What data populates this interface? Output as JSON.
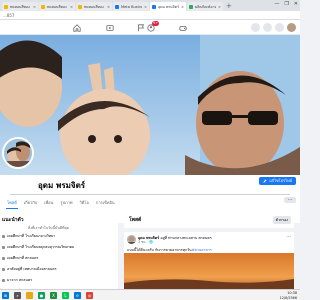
{
  "browser": {
    "tabs": [
      {
        "label": "ทดสอบสีทอง โดยคุณนิ",
        "color": "#f2b705",
        "active": false
      },
      {
        "label": "ทดสอบสีทอง โดยคุณนิ",
        "color": "#f2b705",
        "active": false
      },
      {
        "label": "ทดสอบสีทอง โดยคุณนิ",
        "color": "#f2b705",
        "active": false
      },
      {
        "label": "Meta Business Suite",
        "color": "#1877f2",
        "active": false
      },
      {
        "label": "อุดม พรมจิตร์ | Faceboo",
        "color": "#1877f2",
        "active": true
      },
      {
        "label": "ผลิตภัณฑ์อาหาร (บัญชีทด",
        "color": "#34a853",
        "active": false
      }
    ],
    "tab_close": "×",
    "new_tab": "+",
    "window_controls": [
      "—",
      "❐",
      "✕"
    ],
    "url": "...857"
  },
  "fbnav": {
    "icons": [
      "home-icon",
      "video-icon",
      "flag-icon",
      "groups-icon",
      "gaming-icon"
    ],
    "notification_badge": "9+"
  },
  "profile": {
    "name": "อุดม พรมจิตร์",
    "edit_button": "แก้ไขโปรไฟล์",
    "tabs": [
      {
        "label": "โพสต์",
        "active": true
      },
      {
        "label": "เกี่ยวกับ",
        "active": false
      },
      {
        "label": "เพื่อน",
        "active": false
      },
      {
        "label": "รูปภาพ",
        "active": false
      },
      {
        "label": "วิดีโอ",
        "active": false
      },
      {
        "label": "การเช็คอิน",
        "active": false
      }
    ],
    "more_tab": "···"
  },
  "intro": {
    "title": "แนะนำตัว",
    "subtitle": "สิ่งที่เราทำในวันนี้มันดีที่สุด",
    "lines": [
      "เคยศึกษาที่ โรงเรียนกลางวิทยา",
      "เคยศึกษาที่ โรงเรียนพลุกสมสุวรรณวิทยาคม",
      "เคยศึกษาที่ สกลนคร",
      "อาศัยอยู่ที่ เทศบาลเมืองสกลนคร",
      "มาจาก สกลนคร",
      "ติดตามโดย 6 คน"
    ]
  },
  "posts": {
    "title": "โพสต์",
    "filter_button": "ตัวกรอง",
    "post": {
      "author": "อุดม พรมจิตร์",
      "action": "อยู่ที่ ท่ามกลางทะเลสาบ สกลนคร",
      "time": "3 ชม. · 🌐",
      "text": "แบบนี้ได้ดีนะครับ กับการขายอาหารทุกวัน",
      "link": "#ขายอาหาร",
      "more": "···"
    }
  },
  "taskbar": {
    "time": "10:38",
    "date": "12/6/2566"
  }
}
